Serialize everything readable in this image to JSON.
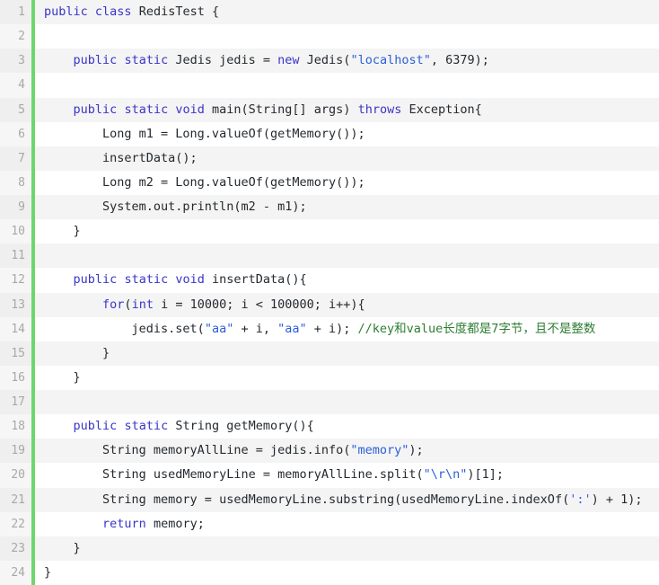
{
  "editor": {
    "name": "java-code-view",
    "language": "Java",
    "colors": {
      "background": "#ffffff",
      "alt_row_background": "#f4f4f4",
      "gutter_background": "#f6f6f6",
      "gutter_alt_background": "#efefef",
      "line_number": "#a8a8a8",
      "change_marker": "#6ed66e",
      "keyword": "#3a34c8",
      "string": "#2b5fd9",
      "comment": "#2e7d32",
      "text": "#24292e"
    },
    "first_line": 1,
    "last_line": 24,
    "total_lines": 24
  },
  "lines": [
    {
      "number": "1",
      "text": "public class RedisTest {",
      "tokens": [
        {
          "t": "public",
          "c": "kw"
        },
        {
          "t": " ",
          "c": "plain"
        },
        {
          "t": "class",
          "c": "kw"
        },
        {
          "t": " RedisTest {",
          "c": "plain"
        }
      ]
    },
    {
      "number": "2",
      "text": "",
      "tokens": []
    },
    {
      "number": "3",
      "text": "    public static Jedis jedis = new Jedis(\"localhost\", 6379);",
      "tokens": [
        {
          "t": "    ",
          "c": "plain"
        },
        {
          "t": "public",
          "c": "kw"
        },
        {
          "t": " ",
          "c": "plain"
        },
        {
          "t": "static",
          "c": "kw"
        },
        {
          "t": " Jedis jedis = ",
          "c": "plain"
        },
        {
          "t": "new",
          "c": "kw"
        },
        {
          "t": " Jedis(",
          "c": "plain"
        },
        {
          "t": "\"localhost\"",
          "c": "str"
        },
        {
          "t": ", 6379);",
          "c": "plain"
        }
      ]
    },
    {
      "number": "4",
      "text": "",
      "tokens": []
    },
    {
      "number": "5",
      "text": "    public static void main(String[] args) throws Exception{",
      "tokens": [
        {
          "t": "    ",
          "c": "plain"
        },
        {
          "t": "public",
          "c": "kw"
        },
        {
          "t": " ",
          "c": "plain"
        },
        {
          "t": "static",
          "c": "kw"
        },
        {
          "t": " ",
          "c": "plain"
        },
        {
          "t": "void",
          "c": "kw"
        },
        {
          "t": " main(String[] args) ",
          "c": "plain"
        },
        {
          "t": "throws",
          "c": "kw"
        },
        {
          "t": " Exception{",
          "c": "plain"
        }
      ]
    },
    {
      "number": "6",
      "text": "        Long m1 = Long.valueOf(getMemory());",
      "tokens": [
        {
          "t": "        Long m1 = Long.valueOf(getMemory());",
          "c": "plain"
        }
      ]
    },
    {
      "number": "7",
      "text": "        insertData();",
      "tokens": [
        {
          "t": "        insertData();",
          "c": "plain"
        }
      ]
    },
    {
      "number": "8",
      "text": "        Long m2 = Long.valueOf(getMemory());",
      "tokens": [
        {
          "t": "        Long m2 = Long.valueOf(getMemory());",
          "c": "plain"
        }
      ]
    },
    {
      "number": "9",
      "text": "        System.out.println(m2 - m1);",
      "tokens": [
        {
          "t": "        System.out.println(m2 - m1);",
          "c": "plain"
        }
      ]
    },
    {
      "number": "10",
      "text": "    }",
      "tokens": [
        {
          "t": "    }",
          "c": "plain"
        }
      ]
    },
    {
      "number": "11",
      "text": "",
      "tokens": []
    },
    {
      "number": "12",
      "text": "    public static void insertData(){",
      "tokens": [
        {
          "t": "    ",
          "c": "plain"
        },
        {
          "t": "public",
          "c": "kw"
        },
        {
          "t": " ",
          "c": "plain"
        },
        {
          "t": "static",
          "c": "kw"
        },
        {
          "t": " ",
          "c": "plain"
        },
        {
          "t": "void",
          "c": "kw"
        },
        {
          "t": " insertData(){",
          "c": "plain"
        }
      ]
    },
    {
      "number": "13",
      "text": "        for(int i = 10000; i < 100000; i++){",
      "tokens": [
        {
          "t": "        ",
          "c": "plain"
        },
        {
          "t": "for",
          "c": "kw"
        },
        {
          "t": "(",
          "c": "plain"
        },
        {
          "t": "int",
          "c": "kw"
        },
        {
          "t": " i = 10000; i < 100000; i++){",
          "c": "plain"
        }
      ]
    },
    {
      "number": "14",
      "text": "            jedis.set(\"aa\" + i, \"aa\" + i); //key和value长度都是7字节，且不是整数",
      "tokens": [
        {
          "t": "            jedis.set(",
          "c": "plain"
        },
        {
          "t": "\"aa\"",
          "c": "str"
        },
        {
          "t": " + i, ",
          "c": "plain"
        },
        {
          "t": "\"aa\"",
          "c": "str"
        },
        {
          "t": " + i); ",
          "c": "plain"
        },
        {
          "t": "//key和value长度都是7字节，且不是整数",
          "c": "cmt"
        }
      ]
    },
    {
      "number": "15",
      "text": "        }",
      "tokens": [
        {
          "t": "        }",
          "c": "plain"
        }
      ]
    },
    {
      "number": "16",
      "text": "    }",
      "tokens": [
        {
          "t": "    }",
          "c": "plain"
        }
      ]
    },
    {
      "number": "17",
      "text": "",
      "tokens": []
    },
    {
      "number": "18",
      "text": "    public static String getMemory(){",
      "tokens": [
        {
          "t": "    ",
          "c": "plain"
        },
        {
          "t": "public",
          "c": "kw"
        },
        {
          "t": " ",
          "c": "plain"
        },
        {
          "t": "static",
          "c": "kw"
        },
        {
          "t": " String getMemory(){",
          "c": "plain"
        }
      ]
    },
    {
      "number": "19",
      "text": "        String memoryAllLine = jedis.info(\"memory\");",
      "tokens": [
        {
          "t": "        String memoryAllLine = jedis.info(",
          "c": "plain"
        },
        {
          "t": "\"memory\"",
          "c": "str"
        },
        {
          "t": ");",
          "c": "plain"
        }
      ]
    },
    {
      "number": "20",
      "text": "        String usedMemoryLine = memoryAllLine.split(\"\\r\\n\")[1];",
      "tokens": [
        {
          "t": "        String usedMemoryLine = memoryAllLine.split(",
          "c": "plain"
        },
        {
          "t": "\"\\r\\n\"",
          "c": "str"
        },
        {
          "t": ")[1];",
          "c": "plain"
        }
      ]
    },
    {
      "number": "21",
      "text": "        String memory = usedMemoryLine.substring(usedMemoryLine.indexOf(':') + 1);",
      "tokens": [
        {
          "t": "        String memory = usedMemoryLine.substring(usedMemoryLine.indexOf(",
          "c": "plain"
        },
        {
          "t": "':'",
          "c": "str"
        },
        {
          "t": ") + 1);",
          "c": "plain"
        }
      ]
    },
    {
      "number": "22",
      "text": "        return memory;",
      "tokens": [
        {
          "t": "        ",
          "c": "plain"
        },
        {
          "t": "return",
          "c": "kw"
        },
        {
          "t": " memory;",
          "c": "plain"
        }
      ]
    },
    {
      "number": "23",
      "text": "    }",
      "tokens": [
        {
          "t": "    }",
          "c": "plain"
        }
      ]
    },
    {
      "number": "24",
      "text": "}",
      "tokens": [
        {
          "t": "}",
          "c": "plain"
        }
      ]
    }
  ]
}
